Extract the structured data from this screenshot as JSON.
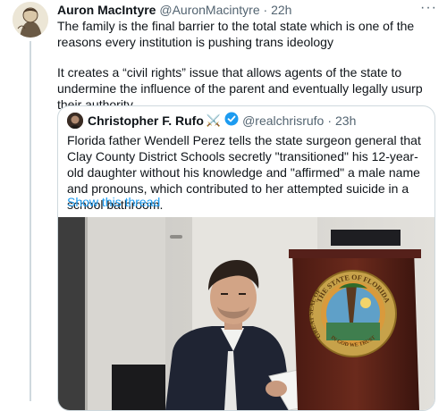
{
  "tweet": {
    "display_name": "Auron MacIntyre",
    "handle": "@AuronMacintyre",
    "time": "22h",
    "separator": "·",
    "more": "···",
    "paragraphs": [
      "The family is the final barrier to the total state which is one of the reasons every institution is pushing trans ideology",
      "It creates a “civil rights” issue that allows agents of the state to undermine the influence of the parent and eventually legally usurp their authority"
    ]
  },
  "quote": {
    "display_name": "Christopher F. Rufo",
    "emoji": "⚔️",
    "handle": "@realchrisrufo",
    "separator": "·",
    "time": "23h",
    "text": "Florida father Wendell Perez tells the state surgeon general that Clay County District Schools secretly \"transitioned\" his 12-year-old daughter without his knowledge and \"affirmed\" a male name and pronouns, which contributed to her attempted suicide in a school bathroom.",
    "show_thread": "Show this thread",
    "seal": {
      "top_text": "THE STATE OF FLORIDA",
      "left_text": "GREAT SEAL OF",
      "bottom_text": "IN GOD WE TRUST"
    }
  },
  "colors": {
    "text": "#0f1419",
    "secondary": "#536471",
    "link": "#1d9bf0",
    "border": "#cfd9de"
  }
}
